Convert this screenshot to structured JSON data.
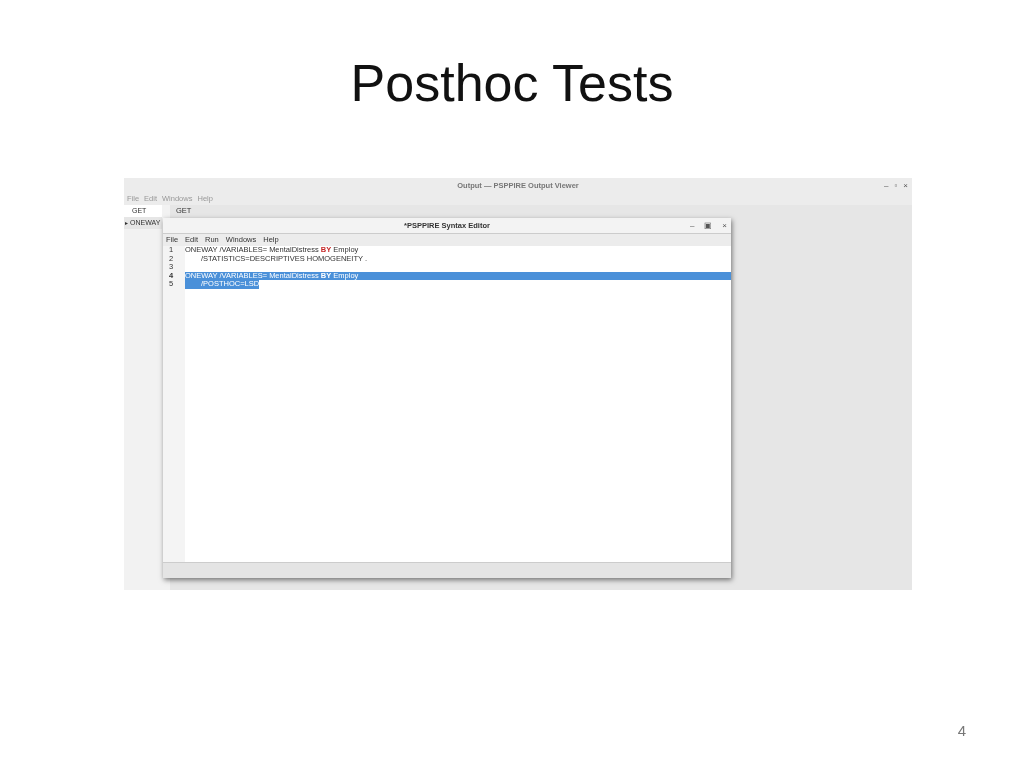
{
  "slide": {
    "title": "Posthoc Tests",
    "page_number": "4"
  },
  "output_viewer": {
    "title": "Output — PSPPIRE Output Viewer",
    "window_controls": [
      "–",
      "▫",
      "×"
    ],
    "menu": [
      "File",
      "Edit",
      "Windows",
      "Help"
    ],
    "tree": [
      {
        "label": "GET",
        "selected": true
      },
      {
        "toggle": "▸",
        "label": "ONEWAY",
        "selected": false
      }
    ],
    "content_heading": "GET"
  },
  "syntax_editor": {
    "title": "*PSPPIRE Syntax Editor",
    "window_controls": [
      "–",
      "▣",
      "×"
    ],
    "menu": [
      "File",
      "Edit",
      "Run",
      "Windows",
      "Help"
    ],
    "lines": [
      {
        "number": "1",
        "indented": false,
        "selected": false,
        "current": false,
        "segments": [
          {
            "kind": "plain",
            "text": "ONEWAY /VARIABLES= MentalDistress "
          },
          {
            "kind": "keyword",
            "text": "BY"
          },
          {
            "kind": "plain",
            "text": " Employ"
          }
        ]
      },
      {
        "number": "2",
        "indented": true,
        "selected": false,
        "current": false,
        "segments": [
          {
            "kind": "plain",
            "text": "/STATISTICS=DESCRIPTIVES HOMOGENEITY ."
          }
        ]
      },
      {
        "number": "3",
        "current": false
      },
      {
        "number": "4",
        "indented": false,
        "selected": true,
        "current": true,
        "segments": [
          {
            "kind": "plain",
            "text": "ONEWAY /VARIABLES= MentalDistress "
          },
          {
            "kind": "keyword",
            "text": "BY"
          },
          {
            "kind": "plain",
            "text": " Employ"
          }
        ]
      },
      {
        "number": "5",
        "indented": true,
        "selected": true,
        "current": false,
        "segments": [
          {
            "kind": "plain",
            "text": "/POSTHOC=LSD"
          }
        ]
      }
    ]
  }
}
